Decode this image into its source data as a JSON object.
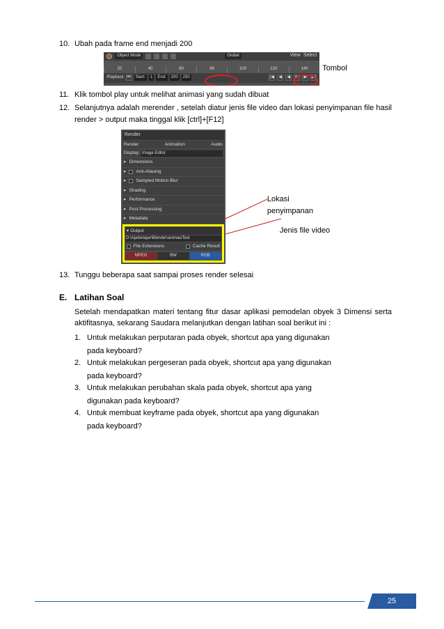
{
  "steps": {
    "s10": {
      "num": "10.",
      "text": "Ubah pada frame end menjadi 200"
    },
    "s11": {
      "num": "11.",
      "text": "Klik tombol play untuk melihat animasi yang sudah dibuat"
    },
    "s12": {
      "num": "12.",
      "text": "Selanjutnya adalah merender , setelah diatur jenis file video dan lokasi penyimpanan file hasil render > output maka tinggal klik [ctrl]+[F12]"
    },
    "s13": {
      "num": "13.",
      "text": "Tunggu beberapa saat sampai proses render selesai"
    }
  },
  "timeline": {
    "header": {
      "mode": "Object Mode",
      "global": "Global",
      "view": "View",
      "select": "Select"
    },
    "ticks": [
      "20",
      "40",
      "60",
      "80",
      "100",
      "120",
      "140"
    ],
    "bottom": {
      "playback": "Playback",
      "start": "Start:",
      "startv": "1",
      "endl": "End:",
      "endv": "200",
      "cur": "250"
    },
    "label": "Tombol"
  },
  "render": {
    "head": "Render",
    "tabs": {
      "r": "Render",
      "a": "Animation",
      "au": "Audio"
    },
    "display": "Display:",
    "imged": "Image Editor",
    "items": [
      "Dimensions",
      "Anti-Aliasing",
      "Sampled Motion Blur",
      "Shading",
      "Performance",
      "Post Processing",
      "Metadata"
    ],
    "output": "Output",
    "path": "D:\\Aja\\belajar\\Blender\\animasiTest",
    "cb1": "File Extensions",
    "cb2": "Cache Result",
    "fmt": "MPEG",
    "btns": [
      "BW",
      "RGB"
    ],
    "anno1": "Lokasi",
    "anno1b": "penyimpanan",
    "anno2": "Jenis file video"
  },
  "sectionE": {
    "letter": "E.",
    "title": "Latihan Soal",
    "intro": "Setelah mendapatkan materi tentang fitur dasar aplikasi pemodelan obyek 3 Dimensi serta aktifitasnya, sekarang Saudara melanjutkan dengan latihan soal berikut ini :",
    "q": [
      {
        "n": "1.",
        "a": "Untuk melakukan perputaran pada obyek, shortcut apa yang digunakan",
        "b": "pada keyboard?"
      },
      {
        "n": "2.",
        "a": "Untuk melakukan pergeseran pada obyek, shortcut apa yang digunakan",
        "b": "pada keyboard?"
      },
      {
        "n": "3.",
        "a": "Untuk melakukan perubahan skala pada obyek, shortcut apa yang",
        "b": "digunakan pada keyboard?"
      },
      {
        "n": "4.",
        "a": "Untuk membuat keyframe pada obyek, shortcut apa yang digunakan",
        "b": "pada keyboard?"
      }
    ]
  },
  "page_number": "25"
}
